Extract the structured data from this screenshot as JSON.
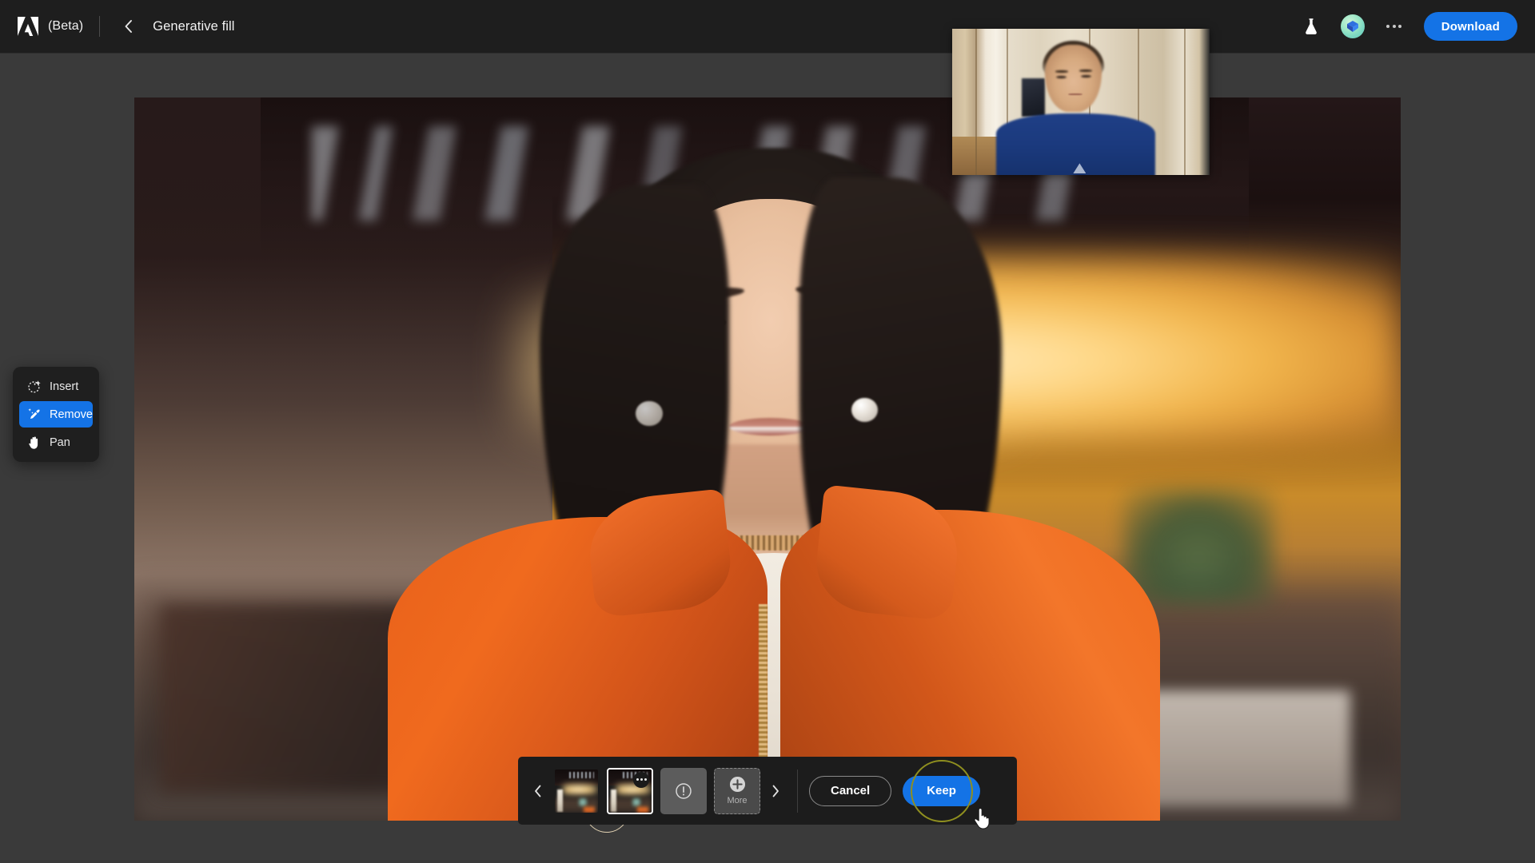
{
  "header": {
    "logo_icon": "adobe-logo-icon",
    "beta_label": "(Beta)",
    "back_icon": "chevron-left-icon",
    "document_title": "Generative fill",
    "lab_icon": "flask-icon",
    "avatar_icon": "gem-avatar-icon",
    "overflow_icon": "ellipsis-icon",
    "download_label": "Download"
  },
  "toolbar": {
    "items": [
      {
        "label": "Insert",
        "icon": "sparkle-selection-icon",
        "active": false
      },
      {
        "label": "Remove",
        "icon": "magic-brush-icon",
        "active": true
      },
      {
        "label": "Pan",
        "icon": "hand-icon",
        "active": false
      }
    ]
  },
  "canvas": {
    "brush_cursor_icon": "brush-circle-cursor",
    "image_alt": "Portrait of a woman in an orange puffer jacket at a blurred cafe"
  },
  "pip": {
    "label": "webcam-self-view",
    "subject_alt": "Person in blue t-shirt seated in a room with light wooden doors"
  },
  "variant_bar": {
    "prev_icon": "chevron-left-icon",
    "next_icon": "chevron-right-icon",
    "thumbnails": [
      {
        "name": "variation-1",
        "selected": false,
        "badge": null
      },
      {
        "name": "variation-2",
        "selected": true,
        "badge": "ellipsis-icon"
      }
    ],
    "error_tile": {
      "icon": "warning-circle-icon"
    },
    "more_tile": {
      "icon": "plus-circle-icon",
      "label": "More"
    },
    "cancel_label": "Cancel",
    "keep_label": "Keep"
  },
  "cursor": {
    "icon": "pointing-hand-cursor",
    "highlight": "click-highlight-ring"
  },
  "colors": {
    "accent_blue": "#1473e6",
    "header_bg": "#1e1e1e",
    "canvas_bg": "#3a3a3a",
    "panel_bg": "#1f1f1f",
    "variant_bar_bg": "#1c1c1c",
    "click_ring": "#8f8f1f"
  }
}
